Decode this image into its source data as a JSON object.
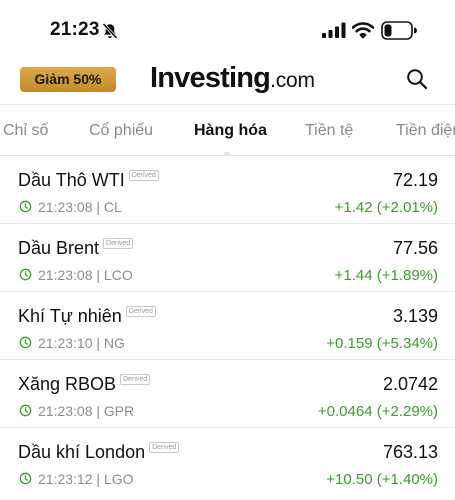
{
  "status_bar": {
    "time": "21:23",
    "icons": [
      "bell-slash-icon",
      "signal-icon",
      "wifi-icon",
      "battery-icon"
    ]
  },
  "header": {
    "promo_label": "Giảm 50%",
    "logo_main": "Investing",
    "logo_suffix": ".com",
    "search_icon": "search-icon"
  },
  "tabs": [
    {
      "label": "Chỉ số",
      "active": false
    },
    {
      "label": "Cổ phiếu",
      "active": false
    },
    {
      "label": "Hàng hóa",
      "active": true
    },
    {
      "label": "Tiền tệ",
      "active": false
    },
    {
      "label": "Tiền điện",
      "active": false
    }
  ],
  "instruments": [
    {
      "name": "Dầu Thô WTI",
      "badge": "Derived",
      "price": "72.19",
      "time": "21:23:08",
      "symbol": "| CL",
      "change": "+1.42 (+2.01%)"
    },
    {
      "name": "Dầu Brent",
      "badge": "Derived",
      "price": "77.56",
      "time": "21:23:08",
      "symbol": "| LCO",
      "change": "+1.44 (+1.89%)"
    },
    {
      "name": "Khí Tự nhiên",
      "badge": "Derived",
      "price": "3.139",
      "time": "21:23:10",
      "symbol": "| NG",
      "change": "+0.159 (+5.34%)"
    },
    {
      "name": "Xăng RBOB",
      "badge": "Derived",
      "price": "2.0742",
      "time": "21:23:08",
      "symbol": "| GPR",
      "change": "+0.0464 (+2.29%)"
    },
    {
      "name": "Dầu khí London",
      "badge": "Derived",
      "price": "763.13",
      "time": "21:23:12",
      "symbol": "| LGO",
      "change": "+10.50 (+1.40%)"
    }
  ],
  "colors": {
    "positive": "#3d9a2f",
    "promo": "#c48a2a",
    "muted": "#8c8c8c"
  }
}
